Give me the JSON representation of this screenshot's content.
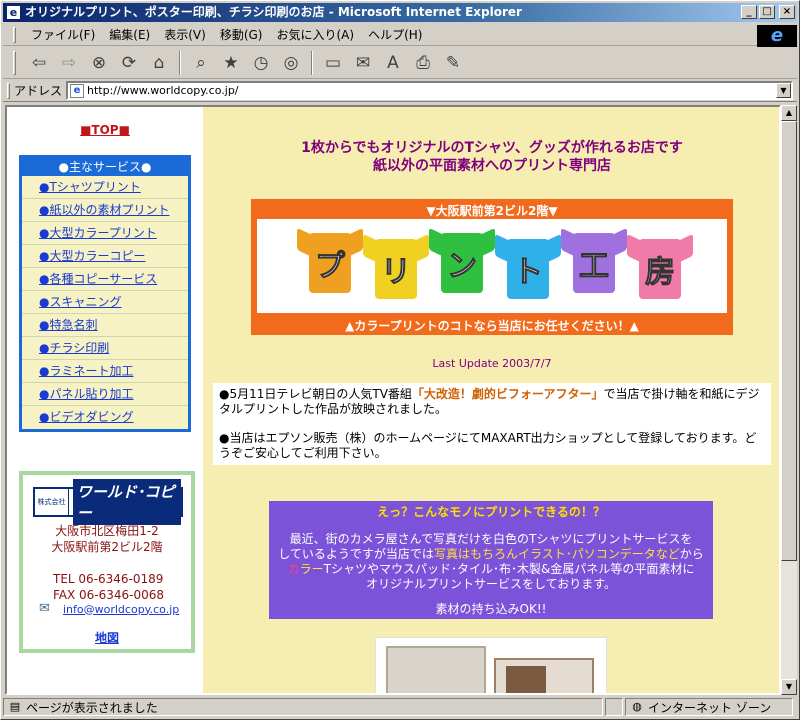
{
  "window": {
    "title": "オリジナルプリント、ポスター印刷、チラシ印刷のお店 - Microsoft Internet Explorer",
    "buttons": [
      "_",
      "□",
      "×"
    ]
  },
  "menu": [
    "ファイル(F)",
    "編集(E)",
    "表示(V)",
    "移動(G)",
    "お気に入り(A)",
    "ヘルプ(H)"
  ],
  "toolbar": {
    "icons": [
      "back-icon",
      "forward-icon",
      "stop-icon",
      "refresh-icon",
      "home-icon",
      "search-icon",
      "favorites-icon",
      "history-icon",
      "channels-icon",
      "fullscreen-icon",
      "mail-icon",
      "font-icon",
      "print-icon",
      "edit-icon"
    ]
  },
  "address": {
    "label": "アドレス",
    "url": "http://www.worldcopy.co.jp/"
  },
  "status": {
    "message": "ページが表示されました",
    "zone": "インターネット ゾーン"
  },
  "sidebar": {
    "top_link": "■TOP■",
    "services_title": "●主なサービス●",
    "services": [
      "●Tシャツプリント",
      "●紙以外の素材プリント",
      "●大型カラープリント",
      "●大型カラーコピー",
      "●各種コピーサービス",
      "●スキャニング",
      "●特急名刺",
      "●チラシ印刷",
      "●ラミネート加工",
      "●パネル貼り加工",
      "●ビデオダビング"
    ],
    "contact": {
      "logo_small": "株式会社",
      "logo_brand": "ワールド･コピー",
      "address1": "大阪市北区梅田1-2",
      "address2": "大阪駅前第2ビル2階",
      "tel": "TEL 06-6346-0189",
      "fax": "FAX 06-6346-0068",
      "email": "info@worldcopy.co.jp",
      "map": "地図"
    }
  },
  "main": {
    "headline1": "1枚からでもオリジナルのTシャツ、グッズが作れるお店です",
    "headline2": "紙以外の平面素材へのプリント専門店",
    "banner_top": "▼大阪駅前第2ビル2階▼",
    "banner_chars": [
      "プ",
      "リ",
      "ン",
      "ト",
      "工",
      "房"
    ],
    "banner_colors": [
      "#f0a020",
      "#f0d020",
      "#30c040",
      "#30b0e8",
      "#a070e0",
      "#f07aa8"
    ],
    "banner_bottom": "▲カラープリントのコトなら当店にお任せください！▲",
    "last_update": "Last Update 2003/7/7",
    "news": {
      "item1_a": "●5月11日テレビ朝日の人気TV番組",
      "item1_hl": "「大改造！劇的ビフォーアフター」",
      "item1_b": "で当店で掛け軸を和紙にデジタルプリントした作品が放映されました。",
      "item2": "●当店はエプソン販売（株）のホームページにてMAXART出力ショップとして登録しております。どうぞご安心してご利用下さい。"
    },
    "promo": {
      "title": "えっ？こんなモノにプリントできるの！？",
      "line1": "最近、街のカメラ屋さんで写真だけを白色のTシャツにプリントサービスを",
      "line2a": "しているようですが当店では",
      "line2hl": "写真はもちろんイラスト･パソコンデータなど",
      "line2b": "から",
      "line3hl1": "カ",
      "line3hl2": "ラ",
      "line3hl3": "ー",
      "line3": "Tシャツやマウスパッド･タイル･布･木製&金属パネル等の平面素材に",
      "line4": "オリジナルプリントサービスをしております。",
      "ok": "素材の持ち込みOK!!"
    }
  }
}
